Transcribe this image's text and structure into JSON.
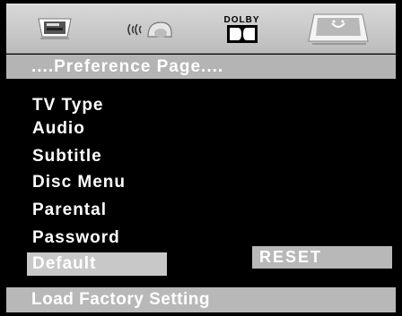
{
  "top_icons": [
    "monitor-icon",
    "audio-icon",
    "dolby-icon",
    "preference-icon"
  ],
  "dolby_label": "DOLBY",
  "page_title": "....Preference Page....",
  "menu": {
    "items": [
      {
        "label": "TV Type"
      },
      {
        "label": "Audio"
      },
      {
        "label": "Subtitle"
      },
      {
        "label": "Disc Menu"
      },
      {
        "label": "Parental"
      },
      {
        "label": "Password"
      },
      {
        "label": "Default"
      }
    ],
    "selected_index": 6
  },
  "submenu": {
    "reset_label": "RESET"
  },
  "status": "Load Factory Setting",
  "colors": {
    "background": "#000000",
    "bar": "#b4b4b4",
    "highlight": "#c8c8c8",
    "text": "#ffffff"
  }
}
